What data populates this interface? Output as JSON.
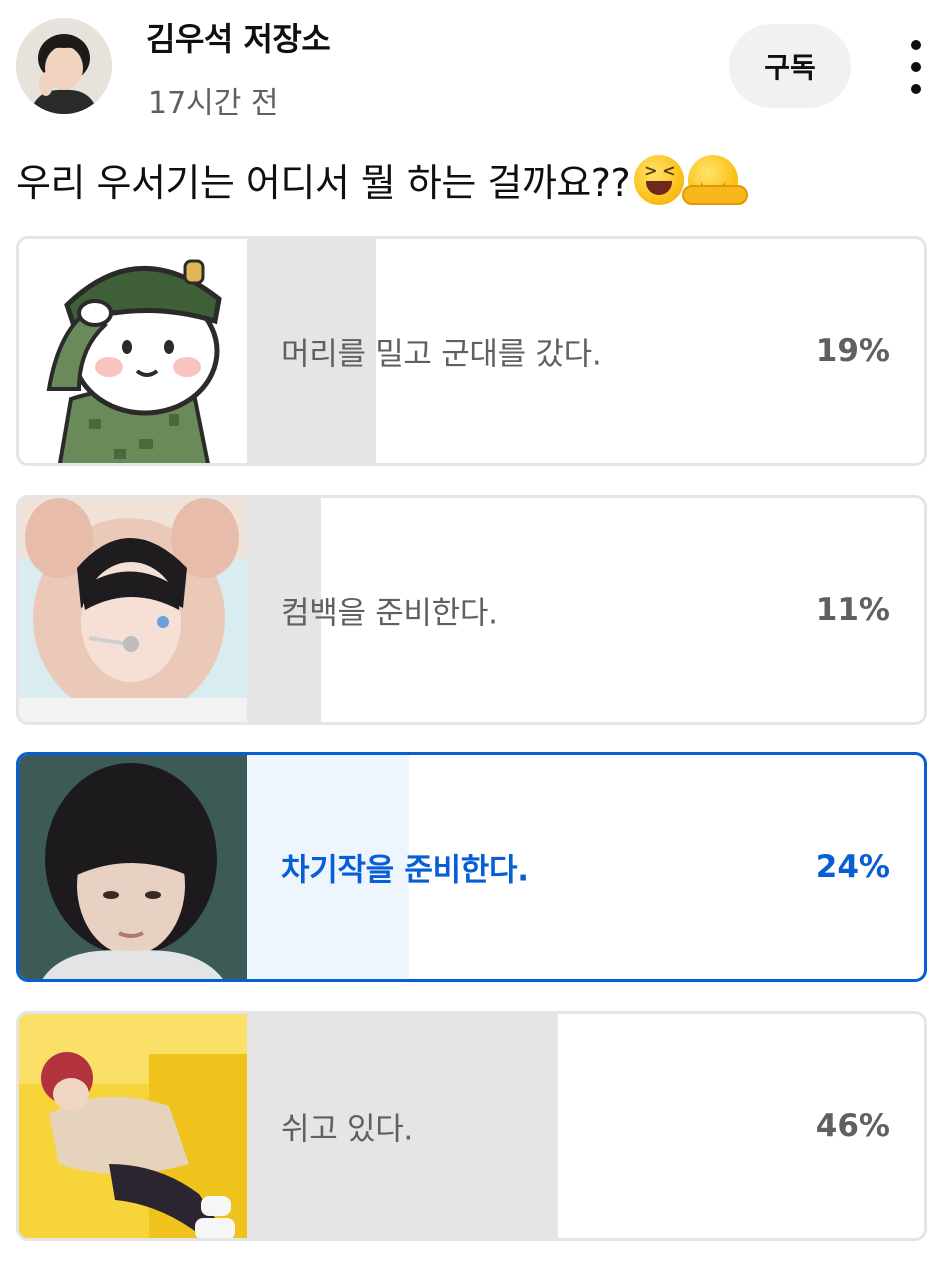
{
  "post": {
    "channel_name": "김우석 저장소",
    "time_ago": "17시간 전",
    "subscribe_label": "구독",
    "question": "우리 우서기는 어디서 뭘 하는 걸까요??",
    "question_emojis": [
      "grinning-squinting-face",
      "hugging-face"
    ]
  },
  "poll": {
    "options": [
      {
        "label": "머리를 밀고 군대를 갔다.",
        "percent": 19,
        "percent_label": "19%",
        "selected": false,
        "image": "cartoon-soldier-salute"
      },
      {
        "label": "컴백을 준비한다.",
        "percent": 11,
        "percent_label": "11%",
        "selected": false,
        "image": "performer-headset-photo"
      },
      {
        "label": "차기작을 준비한다.",
        "percent": 24,
        "percent_label": "24%",
        "selected": true,
        "image": "actor-portrait-photo"
      },
      {
        "label": "쉬고 있다.",
        "percent": 46,
        "percent_label": "46%",
        "selected": false,
        "image": "lying-on-yellow-sofa-photo"
      }
    ]
  },
  "colors": {
    "accent": "#065fd4",
    "bar_fill": "#e5e5e5",
    "selected_fill": "#eef5fd",
    "muted_text": "#606060"
  }
}
